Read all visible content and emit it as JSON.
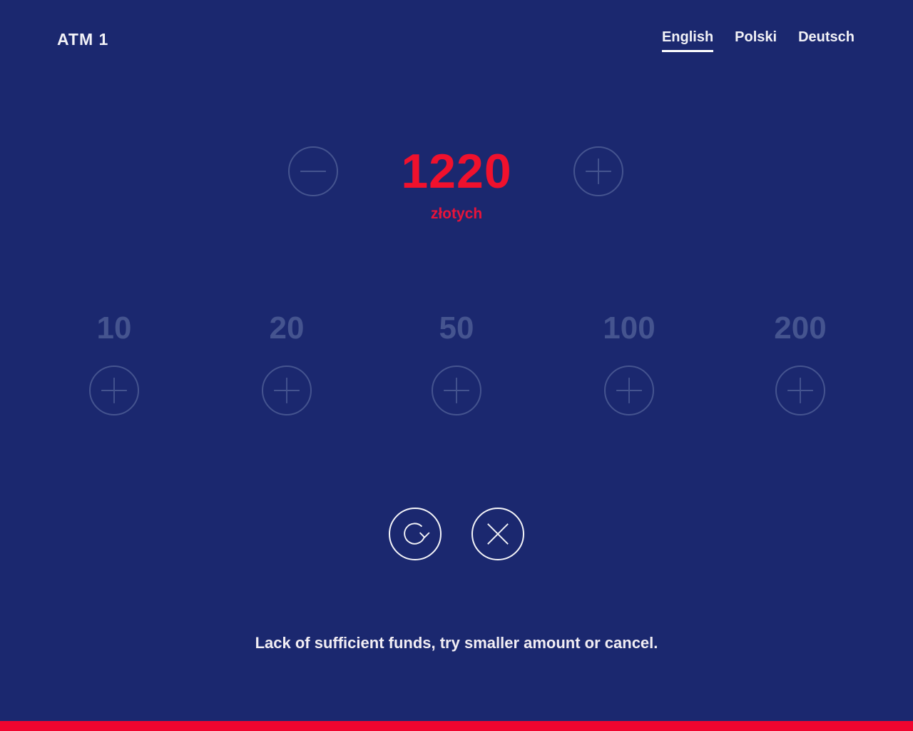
{
  "header": {
    "title": "ATM 1",
    "languages": [
      {
        "label": "English",
        "active": true
      },
      {
        "label": "Polski",
        "active": false
      },
      {
        "label": "Deutsch",
        "active": false
      }
    ]
  },
  "amount": {
    "value": "1220",
    "currency": "złotych",
    "decrease_icon": "minus-icon",
    "increase_icon": "plus-icon"
  },
  "denominations": [
    {
      "label": "10",
      "icon": "plus-icon"
    },
    {
      "label": "20",
      "icon": "plus-icon"
    },
    {
      "label": "50",
      "icon": "plus-icon"
    },
    {
      "label": "100",
      "icon": "plus-icon"
    },
    {
      "label": "200",
      "icon": "plus-icon"
    }
  ],
  "actions": {
    "retry_icon": "refresh-icon",
    "cancel_icon": "close-icon"
  },
  "message": "Lack of sufficient funds, try smaller amount or cancel.",
  "colors": {
    "background": "#1b286f",
    "accent": "#f0112d",
    "disabled": "#45548f",
    "text": "#f2f2f7"
  }
}
